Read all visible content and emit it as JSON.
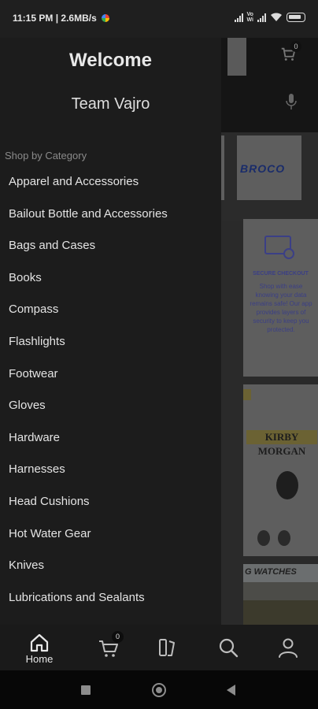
{
  "status_bar": {
    "time_speed": "11:15 PM | 2.6MB/s",
    "battery": "100"
  },
  "underlay": {
    "cart_count": "0",
    "brand_name": "BROCO",
    "secure_checkout_title": "SECURE CHECKOUT",
    "secure_checkout_text": "Shop with ease knowing your data remains safe! Our app provides layers of security to keep you protected.",
    "kirby_label": "KIRBY MORGAN",
    "watches_label": "G WATCHES"
  },
  "drawer": {
    "welcome": "Welcome",
    "username": "Team Vajro",
    "section_title": "Shop by Category",
    "categories": [
      "Apparel and Accessories",
      "Bailout Bottle and Accessories",
      "Bags and Cases",
      "Books",
      "Compass",
      "Flashlights",
      "Footwear",
      "Gloves",
      "Hardware",
      "Harnesses",
      "Head Cushions",
      "Hot Water Gear",
      "Knives",
      "Lubrications and Sealants"
    ]
  },
  "bottom_nav": {
    "home_label": "Home",
    "cart_badge": "0",
    "icons": [
      "home-icon",
      "cart-icon",
      "categories-icon",
      "search-icon",
      "profile-icon"
    ]
  },
  "system_nav": {
    "icons": [
      "recents-icon",
      "home-circle-icon",
      "back-icon"
    ]
  }
}
